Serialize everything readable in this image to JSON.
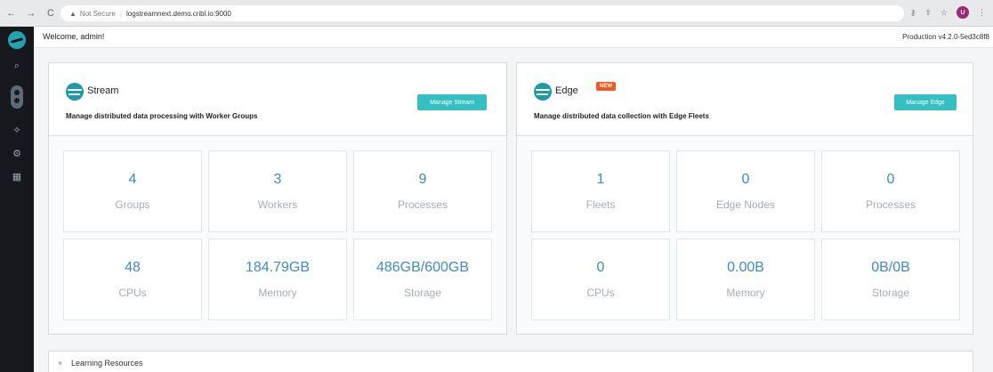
{
  "browser": {
    "not_secure": "Not Secure",
    "url": "logstreamnext.demo.cribl.io:9000",
    "profile_initial": "U"
  },
  "header": {
    "welcome": "Welcome, admin!",
    "version": "Production v4.2.0-5ed3c8f8"
  },
  "stream": {
    "title": "Stream",
    "description": "Manage distributed data processing with Worker Groups",
    "button": "Manage Stream",
    "tiles": [
      {
        "value": "4",
        "label": "Groups"
      },
      {
        "value": "3",
        "label": "Workers"
      },
      {
        "value": "9",
        "label": "Processes"
      },
      {
        "value": "48",
        "label": "CPUs"
      },
      {
        "value": "184.79GB",
        "label": "Memory"
      },
      {
        "value": "486GB/600GB",
        "label": "Storage"
      }
    ]
  },
  "edge": {
    "title": "Edge",
    "badge": "NEW",
    "description": "Manage distributed data collection with Edge Fleets",
    "button": "Manage Edge",
    "tiles": [
      {
        "value": "1",
        "label": "Fleets"
      },
      {
        "value": "0",
        "label": "Edge Nodes"
      },
      {
        "value": "0",
        "label": "Processes"
      },
      {
        "value": "0",
        "label": "CPUs"
      },
      {
        "value": "0.00B",
        "label": "Memory"
      },
      {
        "value": "0B/0B",
        "label": "Storage"
      }
    ]
  },
  "learning": {
    "label": "Learning Resources"
  },
  "colors": {
    "accent": "#34c0c3",
    "value_blue": "#3f8bc0",
    "badge_orange": "#ee5a24",
    "sidebar": "#16181d"
  }
}
